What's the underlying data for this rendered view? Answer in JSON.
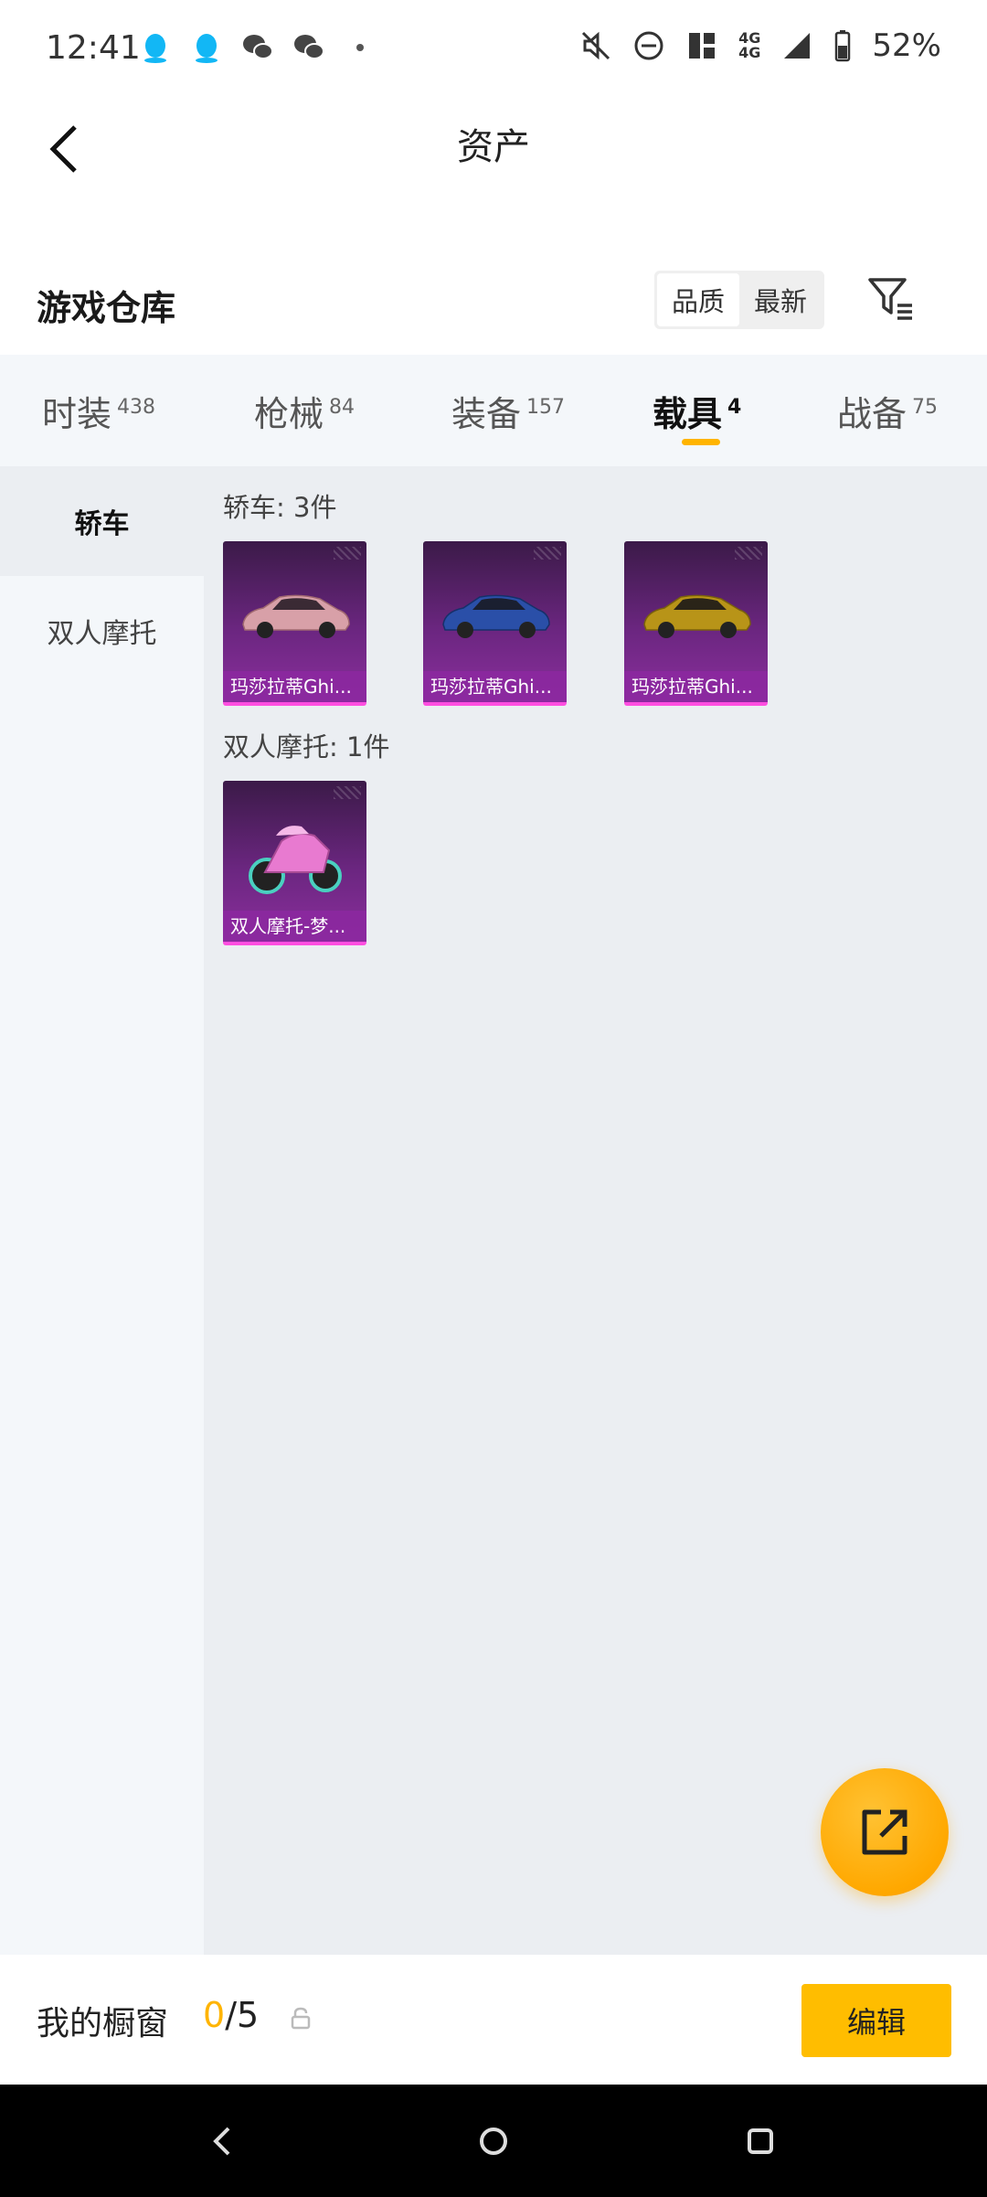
{
  "status_bar": {
    "time": "12:41",
    "left_icons": [
      "qq-icon",
      "qq-icon",
      "wechat-icon",
      "wechat-icon",
      "dot-icon"
    ],
    "right_icons": [
      "mute-icon",
      "dnd-icon",
      "nfc-icon",
      "network-4g-icon",
      "signal-icon",
      "battery-icon"
    ],
    "network_label": "4G",
    "battery": "52%"
  },
  "nav": {
    "title": "资产"
  },
  "section": {
    "title": "游戏仓库",
    "sort_options": [
      "品质",
      "最新"
    ]
  },
  "tabs": [
    {
      "label": "时装",
      "count": "438",
      "active": false
    },
    {
      "label": "枪械",
      "count": "84",
      "active": false
    },
    {
      "label": "装备",
      "count": "157",
      "active": false
    },
    {
      "label": "载具",
      "count": "4",
      "active": true
    },
    {
      "label": "战备",
      "count": "75",
      "active": false
    }
  ],
  "sidebar": {
    "items": [
      "轿车",
      "双人摩托"
    ],
    "active_index": 0
  },
  "groups": [
    {
      "title": "轿车: 3件",
      "items": [
        {
          "label": "玛莎拉蒂Ghi...",
          "color": "#d8a0a8",
          "kind": "car"
        },
        {
          "label": "玛莎拉蒂Ghi...",
          "color": "#2a4fa8",
          "kind": "car"
        },
        {
          "label": "玛莎拉蒂Ghi...",
          "color": "#b89418",
          "kind": "car"
        }
      ]
    },
    {
      "title": "双人摩托: 1件",
      "items": [
        {
          "label": "双人摩托-梦...",
          "color": "#e87ad0",
          "kind": "moto"
        }
      ]
    }
  ],
  "showcase": {
    "label": "我的橱窗",
    "current": "0",
    "total": "/5",
    "edit_label": "编辑"
  },
  "colors": {
    "accent": "#ffb400",
    "card_border": "#ff4ee0"
  }
}
